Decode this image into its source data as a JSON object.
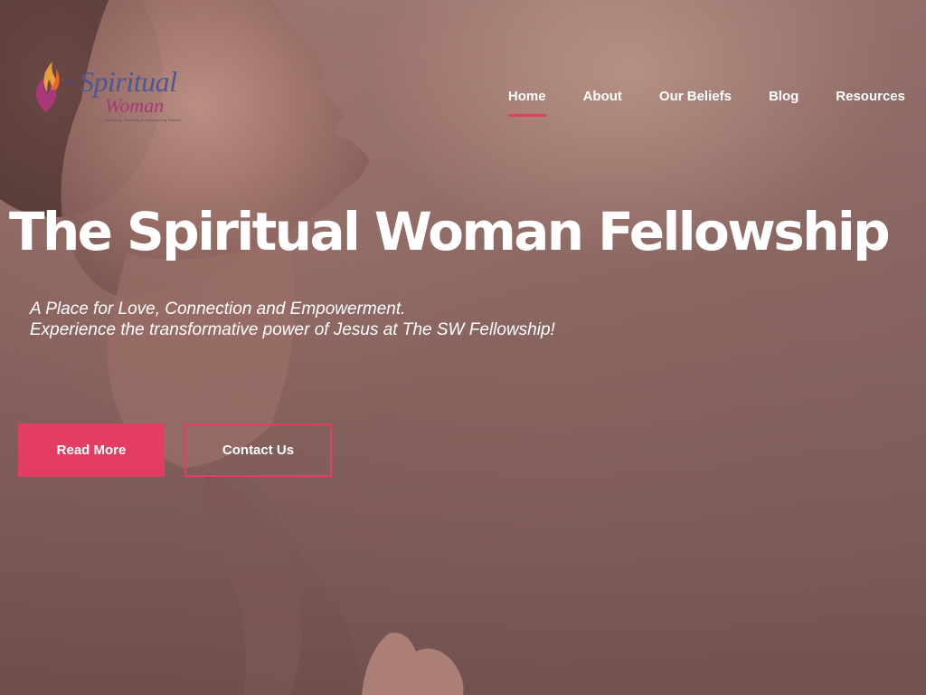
{
  "logo": {
    "the": "The",
    "spiritual": "Spiritual",
    "woman": "Woman",
    "tagline": "Reaching, Teaching & Empowering Women"
  },
  "nav": {
    "items": [
      {
        "label": "Home",
        "active": true
      },
      {
        "label": "About",
        "active": false
      },
      {
        "label": "Our Beliefs",
        "active": false
      },
      {
        "label": "Blog",
        "active": false
      },
      {
        "label": "Resources",
        "active": false
      }
    ]
  },
  "hero": {
    "title": "The Spiritual Woman Fellowship",
    "subtitle_line1": "A Place for Love, Connection and Empowerment.",
    "subtitle_line2": "Experience the transformative power of Jesus at The SW Fellowship!",
    "primary_button": "Read More",
    "secondary_button": "Contact Us",
    "image": "woman-praying-eyes-closed"
  },
  "colors": {
    "accent": "#e33d63",
    "text": "#ffffff",
    "background": "#8d6862",
    "logo_blue": "#4a5896",
    "logo_magenta": "#a83878"
  }
}
